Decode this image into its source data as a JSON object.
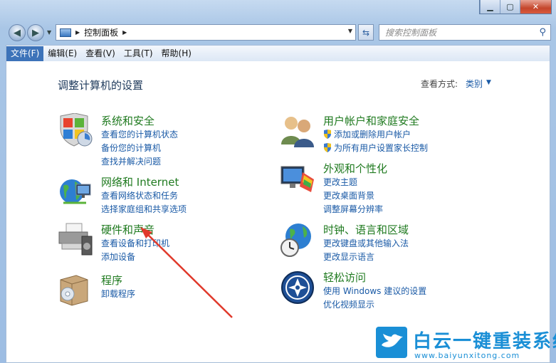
{
  "window": {
    "controls": [
      "minimize",
      "maximize",
      "close"
    ]
  },
  "navigation": {
    "address": "控制面板",
    "search_placeholder": "搜索控制面板"
  },
  "menu": [
    {
      "label": "文件(F)",
      "active": true
    },
    {
      "label": "编辑(E)",
      "active": false
    },
    {
      "label": "查看(V)",
      "active": false
    },
    {
      "label": "工具(T)",
      "active": false
    },
    {
      "label": "帮助(H)",
      "active": false
    }
  ],
  "content": {
    "title": "调整计算机的设置",
    "view_label": "查看方式:",
    "view_value": "类别"
  },
  "categories": [
    {
      "id": "system",
      "title": "系统和安全",
      "icon": "shield-icon",
      "links": [
        "查看您的计算机状态",
        "备份您的计算机",
        "查找并解决问题"
      ]
    },
    {
      "id": "network",
      "title": "网络和 Internet",
      "icon": "globe-network-icon",
      "links": [
        "查看网络状态和任务",
        "选择家庭组和共享选项"
      ]
    },
    {
      "id": "hardware",
      "title": "硬件和声音",
      "icon": "printer-speaker-icon",
      "links": [
        "查看设备和打印机",
        "添加设备"
      ]
    },
    {
      "id": "programs",
      "title": "程序",
      "icon": "programs-box-icon",
      "links": [
        "卸载程序"
      ]
    },
    {
      "id": "users",
      "title": "用户帐户和家庭安全",
      "icon": "users-icon",
      "links": [
        "添加或删除用户帐户",
        "为所有用户设置家长控制"
      ]
    },
    {
      "id": "appearance",
      "title": "外观和个性化",
      "icon": "monitor-palette-icon",
      "links": [
        "更改主题",
        "更改桌面背景",
        "调整屏幕分辨率"
      ]
    },
    {
      "id": "clock",
      "title": "时钟、语言和区域",
      "icon": "globe-clock-icon",
      "links": [
        "更改键盘或其他输入法",
        "更改显示语言"
      ]
    },
    {
      "id": "ease",
      "title": "轻松访问",
      "icon": "ease-of-access-icon",
      "links": [
        "使用 Windows 建议的设置",
        "优化视频显示"
      ]
    }
  ],
  "watermark": {
    "title": "白云一键重装系统",
    "url": "www.baiyunxitong.com"
  },
  "colors": {
    "link": "#1a5aa6",
    "category_title": "#1f7a1f",
    "menu_active": "#3d73b9",
    "annotation_arrow": "#e0392b"
  }
}
